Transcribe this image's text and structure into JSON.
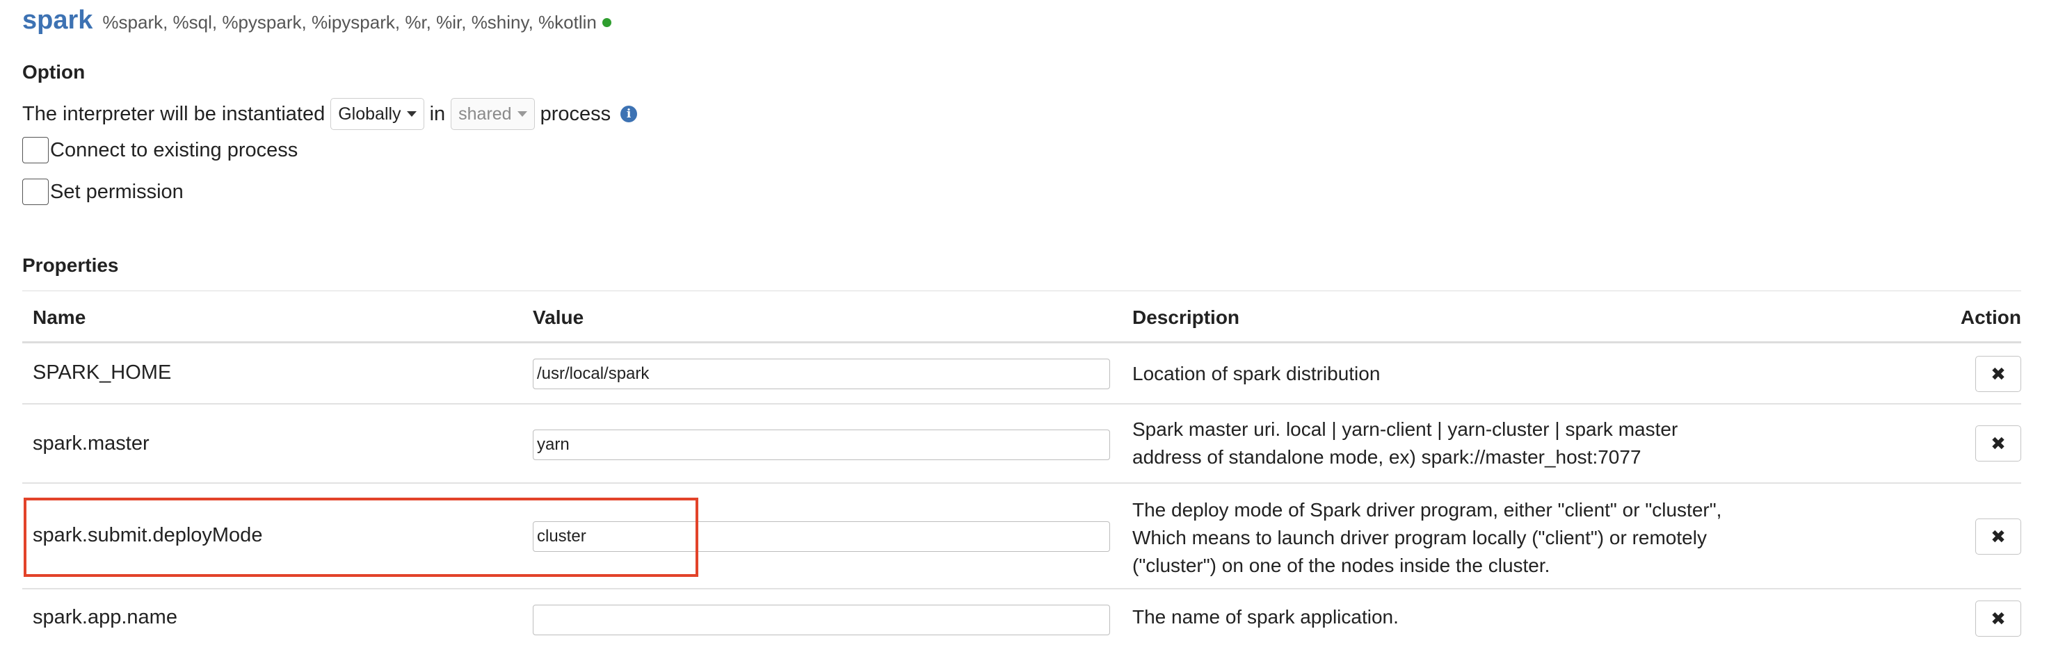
{
  "interpreter": {
    "name": "spark",
    "groups": "%spark, %sql, %pyspark, %ipyspark, %r, %ir, %shiny, %kotlin",
    "status_color": "#2f9e2f"
  },
  "option": {
    "title": "Option",
    "instantiated_prefix": "The interpreter will be instantiated",
    "scope_selected": "Globally",
    "in_text": "in",
    "mode_selected": "shared",
    "process_text": "process",
    "connect_label": "Connect to existing process",
    "connect_checked": false,
    "permission_label": "Set permission",
    "permission_checked": false
  },
  "properties": {
    "title": "Properties",
    "columns": {
      "name": "Name",
      "value": "Value",
      "description": "Description",
      "action": "Action"
    },
    "rows": [
      {
        "name": "SPARK_HOME",
        "value": "/usr/local/spark",
        "description": "Location of spark distribution"
      },
      {
        "name": "spark.master",
        "value": "yarn",
        "description": "Spark master uri. local | yarn-client | yarn-cluster | spark master address of standalone mode, ex) spark://master_host:7077"
      },
      {
        "name": "spark.submit.deployMode",
        "value": "cluster",
        "description": "The deploy mode of Spark driver program, either \"client\" or \"cluster\", Which means to launch driver program locally (\"client\") or remotely (\"cluster\") on one of the nodes inside the cluster.",
        "highlighted": true
      },
      {
        "name": "spark.app.name",
        "value": "",
        "description": "The name of spark application."
      }
    ]
  },
  "colors": {
    "accent": "#3d72b3",
    "highlight": "#e2432a"
  }
}
